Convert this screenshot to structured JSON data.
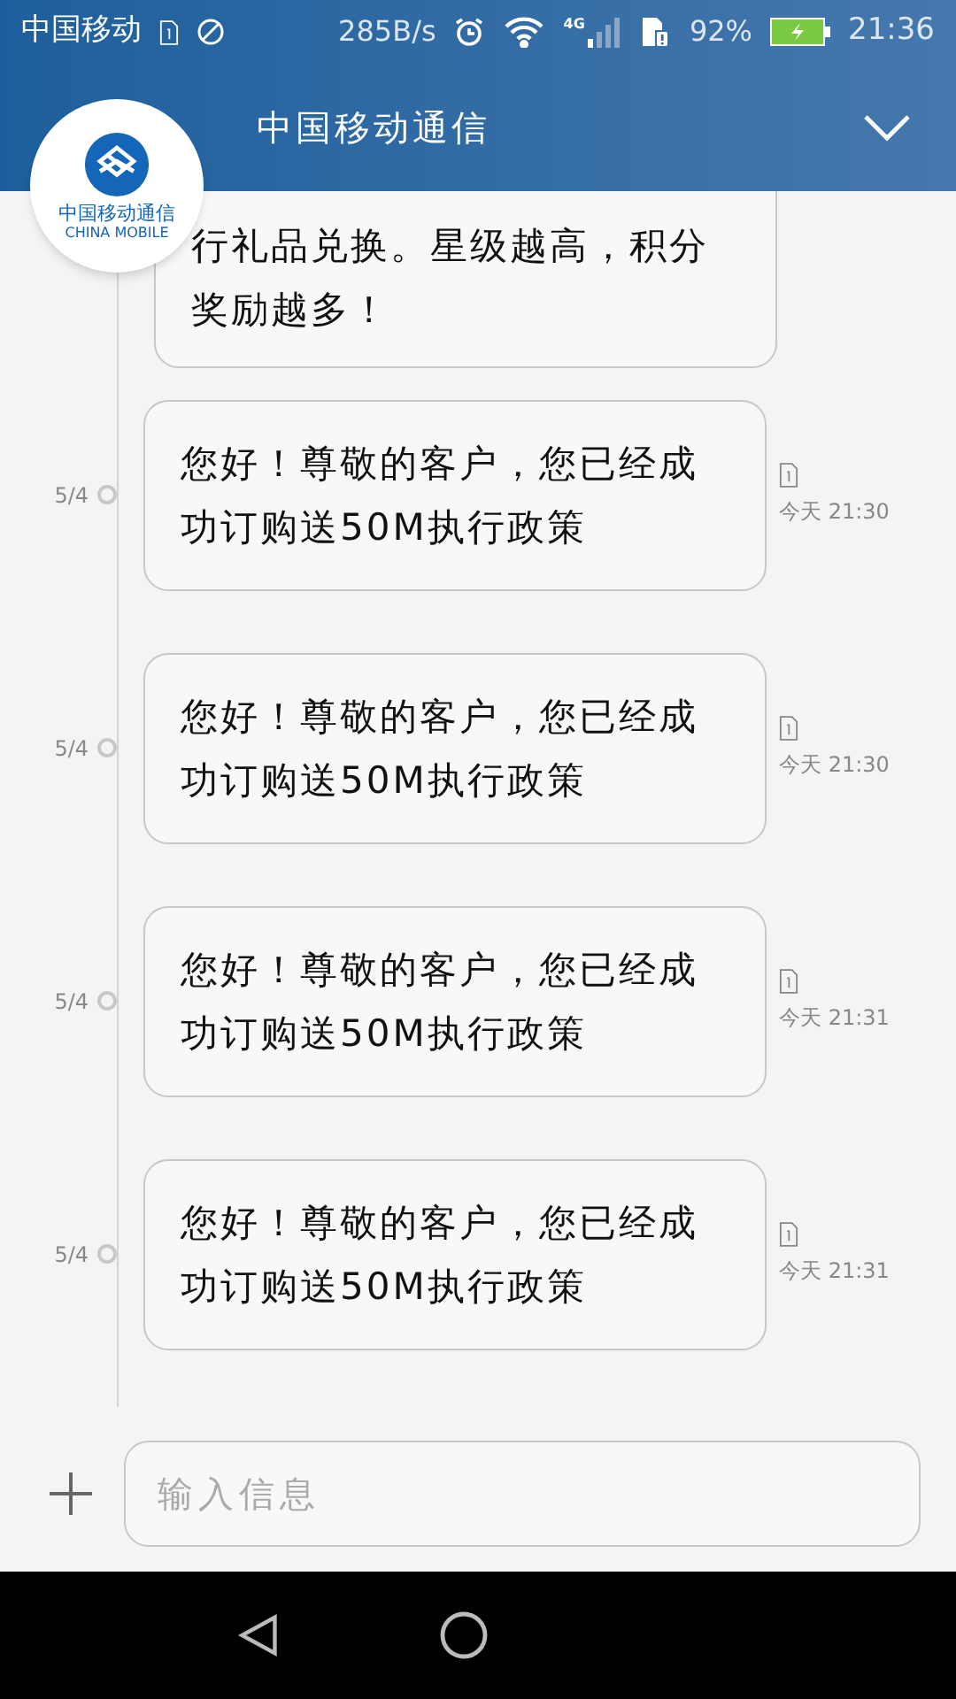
{
  "status_bar": {
    "carrier": "中国移动",
    "speed": "285B/s",
    "network": "4G",
    "battery": "92%",
    "time": "21:36"
  },
  "header": {
    "title": "中国移动通信",
    "logo_text": "中国移动通信",
    "logo_subtext": "CHINA MOBILE"
  },
  "messages": [
    {
      "kind": "partial",
      "text": "行礼品兑换。星级越高，积分奖励越多！"
    },
    {
      "kind": "full",
      "date": "5/4",
      "text": "您好！尊敬的客户，您已经成功订购送50M执行政策",
      "time": "今天 21:30"
    },
    {
      "kind": "full",
      "date": "5/4",
      "text": "您好！尊敬的客户，您已经成功订购送50M执行政策",
      "time": "今天 21:30"
    },
    {
      "kind": "full",
      "date": "5/4",
      "text": "您好！尊敬的客户，您已经成功订购送50M执行政策",
      "time": "今天 21:31"
    },
    {
      "kind": "full",
      "date": "5/4",
      "text": "您好！尊敬的客户，您已经成功订购送50M执行政策",
      "time": "今天 21:31"
    }
  ],
  "composer": {
    "placeholder": "输入信息"
  }
}
